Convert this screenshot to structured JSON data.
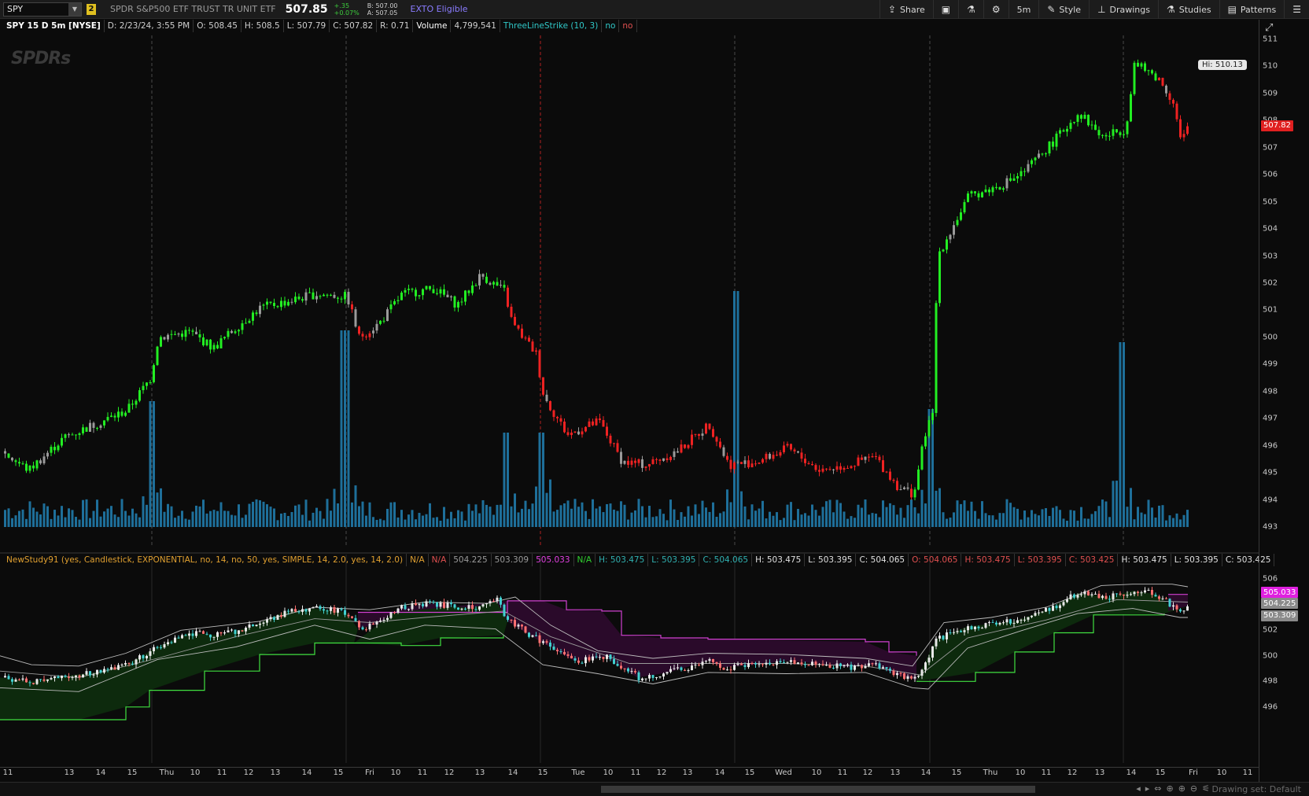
{
  "toolbar": {
    "symbol": "SPY",
    "link_badge": "2",
    "description": "SPDR S&P500 ETF TRUST TR UNIT ETF",
    "last_price": "507.85",
    "change": "+.35",
    "change_pct": "+0.07%",
    "bid": "B: 507.00",
    "ask": "A: 507.05",
    "exto": "EXTO Eligible",
    "buttons": [
      {
        "label": "Share",
        "icon": "share-icon"
      },
      {
        "label": "",
        "icon": "chart-settings-icon"
      },
      {
        "label": "",
        "icon": "flask-icon"
      },
      {
        "label": "",
        "icon": "gear-icon"
      },
      {
        "label": "5m",
        "icon": ""
      },
      {
        "label": "Style",
        "icon": "style-icon"
      },
      {
        "label": "Drawings",
        "icon": "drawings-icon"
      },
      {
        "label": "Studies",
        "icon": "studies-icon"
      },
      {
        "label": "Patterns",
        "icon": "patterns-icon"
      },
      {
        "label": "",
        "icon": "menu-icon"
      }
    ]
  },
  "upper_info": {
    "title": "SPY 15 D 5m [NYSE]",
    "date": "D: 2/23/24, 3:55 PM",
    "open": "O: 508.45",
    "high": "H: 508.5",
    "low": "L: 507.79",
    "close": "C: 507.82",
    "range": "R: 0.71",
    "volume_label": "Volume",
    "volume_value": "4,799,541",
    "study": "ThreeLineStrike (10, 3)",
    "study_val1": "no",
    "study_val2": "no"
  },
  "lower_info": {
    "study": "NewStudy91 (yes, Candlestick, EXPONENTIAL, no, 14, no, 50, yes, SIMPLE, 14, 2.0, yes, 14, 2.0)",
    "items": [
      {
        "text": "N/A",
        "color": "#e0a030"
      },
      {
        "text": "N/A",
        "color": "#e05050"
      },
      {
        "text": "504.225",
        "color": "#9a9a9a"
      },
      {
        "text": "503.309",
        "color": "#9a9a9a"
      },
      {
        "text": "505.033",
        "color": "#e040e0"
      },
      {
        "text": "N/A",
        "color": "#30d030"
      },
      {
        "text": "H: 503.475",
        "color": "#30b0b0"
      },
      {
        "text": "L: 503.395",
        "color": "#30b0b0"
      },
      {
        "text": "C: 504.065",
        "color": "#30b0b0"
      },
      {
        "text": "H: 503.475",
        "color": "#e0e0e0"
      },
      {
        "text": "L: 503.395",
        "color": "#e0e0e0"
      },
      {
        "text": "C: 504.065",
        "color": "#e0e0e0"
      },
      {
        "text": "O: 504.065",
        "color": "#e05050"
      },
      {
        "text": "H: 503.475",
        "color": "#e05050"
      },
      {
        "text": "L: 503.395",
        "color": "#e05050"
      },
      {
        "text": "C: 503.425",
        "color": "#e05050"
      },
      {
        "text": "H: 503.475",
        "color": "#e0e0e0"
      },
      {
        "text": "L: 503.395",
        "color": "#e0e0e0"
      },
      {
        "text": "C: 503.425",
        "color": "#e0e0e0"
      }
    ]
  },
  "upper_axis": {
    "ticks": [
      "511",
      "510",
      "509",
      "508",
      "507",
      "506",
      "505",
      "504",
      "503",
      "502",
      "501",
      "500",
      "499",
      "498",
      "497",
      "496",
      "495",
      "494",
      "493"
    ],
    "last_badge": "507.82",
    "hi_label": "Hi: 510.13"
  },
  "lower_axis": {
    "ticks": [
      "506",
      "504",
      "502",
      "500",
      "498",
      "496"
    ],
    "badges": [
      {
        "text": "505.033",
        "bg": "#e020e0",
        "fg": "#ffffff",
        "value": 505.033
      },
      {
        "text": "504.225",
        "bg": "#8a8a8a",
        "fg": "#ffffff",
        "value": 504.225
      },
      {
        "text": "503.309",
        "bg": "#8a8a8a",
        "fg": "#ffffff",
        "value": 503.309
      }
    ]
  },
  "time_axis": {
    "labels": [
      "11",
      "13",
      "14",
      "15",
      "Thu",
      "10",
      "11",
      "12",
      "13",
      "14",
      "15",
      "Fri",
      "10",
      "11",
      "12",
      "13",
      "14",
      "15",
      "Tue",
      "10",
      "11",
      "12",
      "13",
      "14",
      "15",
      "Wed",
      "10",
      "11",
      "12",
      "13",
      "14",
      "15",
      "Thu",
      "10",
      "11",
      "12",
      "13",
      "14",
      "15",
      "Fri",
      "10",
      "11"
    ]
  },
  "scrollbar": {
    "drawing_set": "Drawing set: Default"
  },
  "logo": "SPDRs",
  "colors": {
    "up": "#22ee22",
    "down": "#ee2222",
    "neutral": "#9a9a9a",
    "volume": "#1e6f9a",
    "cloud_green": "#0d2a0d",
    "cloud_purple": "#2a0a2a",
    "line_green": "#40e040",
    "line_purple": "#d040d0"
  },
  "chart_data": [
    {
      "type": "candlestick",
      "title": "SPY 15 D 5m [NYSE]",
      "ylim": [
        493,
        511
      ],
      "price_path": [
        [
          0,
          495.8
        ],
        [
          35,
          495.1
        ],
        [
          80,
          496.3
        ],
        [
          120,
          496.8
        ],
        [
          160,
          497.3
        ],
        [
          190,
          498.5
        ],
        [
          200,
          500.0
        ],
        [
          240,
          500.2
        ],
        [
          270,
          499.6
        ],
        [
          300,
          500.4
        ],
        [
          330,
          501.1
        ],
        [
          360,
          501.3
        ],
        [
          400,
          501.6
        ],
        [
          440,
          501.5
        ],
        [
          455,
          500.0
        ],
        [
          480,
          500.5
        ],
        [
          510,
          501.6
        ],
        [
          550,
          501.8
        ],
        [
          580,
          501.2
        ],
        [
          610,
          502.3
        ],
        [
          640,
          501.7
        ],
        [
          650,
          500.5
        ],
        [
          680,
          499.4
        ],
        [
          690,
          497.8
        ],
        [
          720,
          496.4
        ],
        [
          760,
          496.9
        ],
        [
          790,
          495.4
        ],
        [
          820,
          495.3
        ],
        [
          860,
          495.8
        ],
        [
          900,
          496.8
        ],
        [
          925,
          495.3
        ],
        [
          960,
          495.4
        ],
        [
          1000,
          495.9
        ],
        [
          1040,
          495.1
        ],
        [
          1080,
          495.3
        ],
        [
          1110,
          495.6
        ],
        [
          1140,
          494.5
        ],
        [
          1160,
          494.2
        ],
        [
          1175,
          496.5
        ],
        [
          1185,
          497.2
        ],
        [
          1190,
          503.0
        ],
        [
          1230,
          505.2
        ],
        [
          1270,
          505.6
        ],
        [
          1300,
          506.1
        ],
        [
          1340,
          507.3
        ],
        [
          1370,
          508.3
        ],
        [
          1400,
          507.4
        ],
        [
          1430,
          507.7
        ],
        [
          1440,
          510.1
        ],
        [
          1470,
          509.6
        ],
        [
          1490,
          508.7
        ],
        [
          1500,
          507.2
        ],
        [
          1510,
          507.82
        ]
      ],
      "volume_spikes": [
        190,
        437,
        642,
        686,
        934,
        1180,
        1426
      ],
      "up_segments": [
        [
          0,
          440
        ],
        [
          480,
          640
        ],
        [
          1160,
          1470
        ]
      ],
      "down_segments": [
        [
          440,
          480
        ],
        [
          640,
          1160
        ],
        [
          1470,
          1510
        ]
      ]
    },
    {
      "type": "candlestick",
      "title": "NewStudy91",
      "ylim": [
        495,
        507
      ],
      "price_path": [
        [
          0,
          498.3
        ],
        [
          40,
          498.0
        ],
        [
          80,
          498.4
        ],
        [
          120,
          498.7
        ],
        [
          160,
          499.3
        ],
        [
          200,
          500.7
        ],
        [
          240,
          501.8
        ],
        [
          280,
          501.6
        ],
        [
          320,
          502.3
        ],
        [
          360,
          503.4
        ],
        [
          400,
          503.7
        ],
        [
          440,
          503.4
        ],
        [
          455,
          502.1
        ],
        [
          480,
          502.5
        ],
        [
          510,
          503.8
        ],
        [
          550,
          504.1
        ],
        [
          600,
          503.7
        ],
        [
          630,
          504.4
        ],
        [
          645,
          502.7
        ],
        [
          690,
          501.0
        ],
        [
          730,
          499.6
        ],
        [
          770,
          499.9
        ],
        [
          810,
          498.3
        ],
        [
          850,
          498.7
        ],
        [
          900,
          499.6
        ],
        [
          920,
          499.1
        ],
        [
          960,
          499.3
        ],
        [
          1000,
          499.6
        ],
        [
          1040,
          499.4
        ],
        [
          1080,
          499.1
        ],
        [
          1110,
          499.3
        ],
        [
          1140,
          498.5
        ],
        [
          1165,
          498.1
        ],
        [
          1190,
          501.3
        ],
        [
          1230,
          502.3
        ],
        [
          1290,
          502.7
        ],
        [
          1330,
          503.6
        ],
        [
          1370,
          504.9
        ],
        [
          1410,
          504.6
        ],
        [
          1440,
          505.1
        ],
        [
          1470,
          504.8
        ],
        [
          1495,
          503.5
        ],
        [
          1510,
          503.9
        ]
      ],
      "green_floor": [
        [
          0,
          495.0
        ],
        [
          100,
          495.0
        ],
        [
          160,
          496.0
        ],
        [
          190,
          497.3
        ],
        [
          260,
          498.8
        ],
        [
          330,
          500.1
        ],
        [
          400,
          501.0
        ],
        [
          450,
          501.0
        ],
        [
          510,
          500.8
        ],
        [
          560,
          501.4
        ],
        [
          640,
          501.6
        ]
      ],
      "green_floor2": [
        [
          1165,
          498.0
        ],
        [
          1240,
          498.7
        ],
        [
          1290,
          500.3
        ],
        [
          1340,
          501.8
        ],
        [
          1390,
          503.2
        ],
        [
          1480,
          503.3
        ]
      ],
      "purple_ceiling": [
        [
          455,
          503.4
        ],
        [
          505,
          503.4
        ],
        [
          645,
          504.3
        ],
        [
          690,
          504.3
        ],
        [
          720,
          503.6
        ],
        [
          765,
          503.5
        ],
        [
          790,
          501.6
        ],
        [
          840,
          501.4
        ],
        [
          900,
          501.3
        ],
        [
          1100,
          501.1
        ],
        [
          1130,
          500.3
        ],
        [
          1165,
          500.0
        ]
      ],
      "purple_ceiling2": [
        [
          1485,
          504.8
        ],
        [
          1510,
          504.8
        ]
      ],
      "bollinger_upper": [
        [
          0,
          500.0
        ],
        [
          40,
          499.3
        ],
        [
          100,
          499.2
        ],
        [
          160,
          500.2
        ],
        [
          230,
          502.0
        ],
        [
          330,
          502.7
        ],
        [
          400,
          503.8
        ],
        [
          470,
          503.6
        ],
        [
          540,
          504.2
        ],
        [
          620,
          504.1
        ],
        [
          655,
          504.6
        ],
        [
          700,
          502.4
        ],
        [
          760,
          500.4
        ],
        [
          830,
          499.8
        ],
        [
          900,
          500.2
        ],
        [
          1000,
          500.1
        ],
        [
          1100,
          499.8
        ],
        [
          1160,
          499.2
        ],
        [
          1200,
          502.6
        ],
        [
          1260,
          503.0
        ],
        [
          1330,
          503.8
        ],
        [
          1400,
          505.5
        ],
        [
          1440,
          505.6
        ],
        [
          1490,
          505.6
        ],
        [
          1510,
          505.4
        ]
      ],
      "bollinger_lower": [
        [
          0,
          497.5
        ],
        [
          100,
          497.2
        ],
        [
          200,
          499.7
        ],
        [
          300,
          500.7
        ],
        [
          400,
          502.4
        ],
        [
          470,
          501.3
        ],
        [
          540,
          502.4
        ],
        [
          630,
          502.1
        ],
        [
          690,
          499.3
        ],
        [
          760,
          498.6
        ],
        [
          830,
          497.8
        ],
        [
          900,
          498.7
        ],
        [
          1000,
          498.6
        ],
        [
          1100,
          498.7
        ],
        [
          1160,
          497.5
        ],
        [
          1180,
          497.4
        ],
        [
          1230,
          500.6
        ],
        [
          1300,
          502.0
        ],
        [
          1370,
          503.3
        ],
        [
          1440,
          503.7
        ],
        [
          1500,
          503.0
        ],
        [
          1510,
          503.0
        ]
      ],
      "ema_line": [
        [
          0,
          498.8
        ],
        [
          100,
          498.3
        ],
        [
          200,
          499.8
        ],
        [
          300,
          501.5
        ],
        [
          400,
          502.9
        ],
        [
          470,
          502.6
        ],
        [
          540,
          503.0
        ],
        [
          640,
          503.5
        ],
        [
          700,
          501.5
        ],
        [
          800,
          499.4
        ],
        [
          900,
          499.4
        ],
        [
          1000,
          499.4
        ],
        [
          1100,
          499.2
        ],
        [
          1170,
          498.5
        ],
        [
          1230,
          501.4
        ],
        [
          1330,
          502.8
        ],
        [
          1420,
          504.4
        ],
        [
          1510,
          504.2
        ]
      ]
    }
  ]
}
